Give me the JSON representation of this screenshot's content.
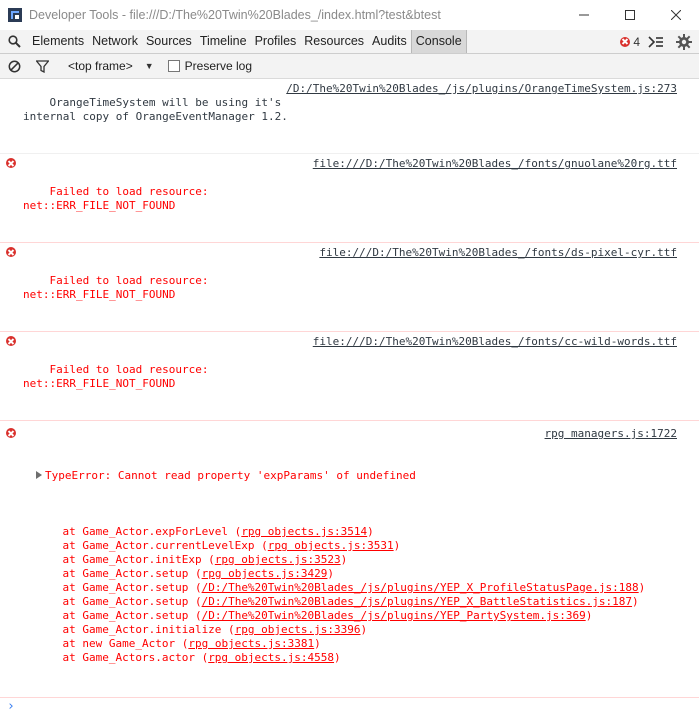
{
  "window": {
    "title": "Developer Tools - file:///D:/The%20Twin%20Blades_/index.html?test&btest"
  },
  "tabs": {
    "items": [
      "Elements",
      "Network",
      "Sources",
      "Timeline",
      "Profiles",
      "Resources",
      "Audits",
      "Console"
    ],
    "active": "Console",
    "error_count": "4"
  },
  "console_toolbar": {
    "frame_selector": "<top frame>",
    "preserve_log_label": "Preserve log"
  },
  "messages": [
    {
      "type": "log",
      "text": "OrangeTimeSystem will be using it's\ninternal copy of OrangeEventManager 1.2.",
      "source": "/D:/The%20Twin%20Blades_/js/plugins/OrangeTimeSystem.js:273"
    },
    {
      "type": "error",
      "text": "Failed to load resource:\nnet::ERR_FILE_NOT_FOUND",
      "source": "file:///D:/The%20Twin%20Blades_/fonts/gnuolane%20rg.ttf"
    },
    {
      "type": "error",
      "text": "Failed to load resource:\nnet::ERR_FILE_NOT_FOUND",
      "source": "file:///D:/The%20Twin%20Blades_/fonts/ds-pixel-cyr.ttf"
    },
    {
      "type": "error",
      "text": "Failed to load resource:\nnet::ERR_FILE_NOT_FOUND",
      "source": "file:///D:/The%20Twin%20Blades_/fonts/cc-wild-words.ttf"
    }
  ],
  "type_error": {
    "text": "TypeError: Cannot read property 'expParams' of undefined",
    "source": "rpg managers.js:1722",
    "trace": [
      {
        "pre": "    at Game_Actor.expForLevel (",
        "link": "rpg objects.js:3514",
        "post": ")"
      },
      {
        "pre": "    at Game_Actor.currentLevelExp (",
        "link": "rpg objects.js:3531",
        "post": ")"
      },
      {
        "pre": "    at Game_Actor.initExp (",
        "link": "rpg objects.js:3523",
        "post": ")"
      },
      {
        "pre": "    at Game_Actor.setup (",
        "link": "rpg objects.js:3429",
        "post": ")"
      },
      {
        "pre": "    at Game_Actor.setup (",
        "link": "/D:/The%20Twin%20Blades_/js/plugins/YEP_X_ProfileStatusPage.js:188",
        "post": ")"
      },
      {
        "pre": "    at Game_Actor.setup (",
        "link": "/D:/The%20Twin%20Blades_/js/plugins/YEP_X_BattleStatistics.js:187",
        "post": ")"
      },
      {
        "pre": "    at Game_Actor.setup (",
        "link": "/D:/The%20Twin%20Blades_/js/plugins/YEP_PartySystem.js:369",
        "post": ")"
      },
      {
        "pre": "    at Game_Actor.initialize (",
        "link": "rpg objects.js:3396",
        "post": ")"
      },
      {
        "pre": "    at new Game_Actor (",
        "link": "rpg objects.js:3381",
        "post": ")"
      },
      {
        "pre": "    at Game_Actors.actor (",
        "link": "rpg objects.js:4558",
        "post": ")"
      }
    ]
  },
  "prompt": {
    "symbol": "›"
  },
  "colors": {
    "error": "#ff0000",
    "error_icon": "#d9302c",
    "prompt": "#367cf1"
  },
  "icons": [
    "devtools-app-icon",
    "minimize-icon",
    "maximize-icon",
    "close-icon",
    "search-icon",
    "error-icon",
    "drawer-toggle-icon",
    "gear-icon",
    "clear-console-icon",
    "filter-icon",
    "dropdown-arrow-icon",
    "expand-triangle-icon",
    "prompt-chevron-icon"
  ]
}
